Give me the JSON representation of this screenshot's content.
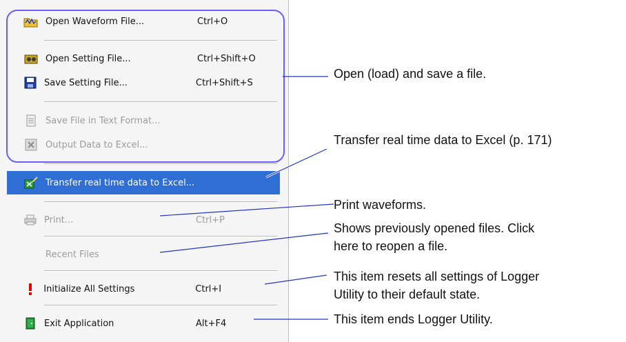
{
  "menu": {
    "items": [
      {
        "label": "Open Waveform File...",
        "shortcut": "Ctrl+O",
        "icon": "open-waveform-icon",
        "enabled": true
      },
      {
        "label": "Open Setting File...",
        "shortcut": "Ctrl+Shift+O",
        "icon": "open-setting-icon",
        "enabled": true
      },
      {
        "label": "Save Setting File...",
        "shortcut": "Ctrl+Shift+S",
        "icon": "save-icon",
        "enabled": true
      },
      {
        "label": "Save File in Text Format...",
        "shortcut": "",
        "icon": "text-file-icon",
        "enabled": false
      },
      {
        "label": "Output Data to Excel...",
        "shortcut": "",
        "icon": "excel-output-icon",
        "enabled": false
      },
      {
        "label": "Transfer real time data to Excel...",
        "shortcut": "",
        "icon": "excel-transfer-icon",
        "enabled": true,
        "highlighted": true
      },
      {
        "label": "Print...",
        "shortcut": "Ctrl+P",
        "icon": "printer-icon",
        "enabled": false
      },
      {
        "label": "Recent Files",
        "shortcut": "",
        "icon": "",
        "enabled": false
      },
      {
        "label": "Initialize All Settings",
        "shortcut": "Ctrl+I",
        "icon": "exclamation-icon",
        "enabled": true
      },
      {
        "label": "Exit Application",
        "shortcut": "Alt+F4",
        "icon": "exit-door-icon",
        "enabled": true
      }
    ]
  },
  "callouts": {
    "open_save": "Open (load) and save a file.",
    "transfer": "Transfer real time data to Excel (p. 171)",
    "print": "Print waveforms.",
    "recent_line1": "Shows previously opened files. Click",
    "recent_line2": "here to reopen a file.",
    "init_line1": "This item resets all settings of Logger",
    "init_line2": "Utility to their default state.",
    "exit": "This item ends Logger Utility."
  },
  "colors": {
    "frame": "#6a5cff",
    "highlight": "#2f6fd3",
    "leader_line": "#2233cc",
    "exclamation": "#e00000"
  }
}
